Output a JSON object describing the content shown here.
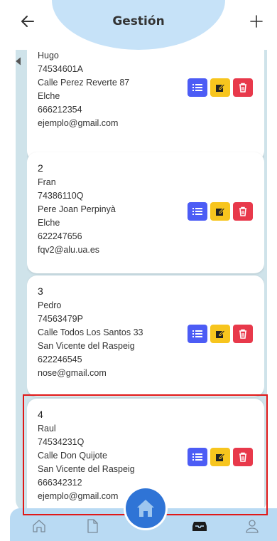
{
  "header": {
    "title": "Gestión",
    "back_icon": "arrow-left-icon",
    "add_icon": "plus-icon"
  },
  "cards": [
    {
      "id": "",
      "name": "Hugo",
      "dni": "74534601A",
      "address": "Calle Perez Reverte 87",
      "city": "Elche",
      "phone": "666212354",
      "email": "ejemplo@gmail.com"
    },
    {
      "id": "2",
      "name": "Fran",
      "dni": "74386110Q",
      "address": "Pere Joan Perpinyà",
      "city": "Elche",
      "phone": "622247656",
      "email": "fqv2@alu.ua.es"
    },
    {
      "id": "3",
      "name": "Pedro",
      "dni": "74563479P",
      "address": "Calle Todos Los Santos 33",
      "city": "San Vicente del Raspeig",
      "phone": "622246545",
      "email": "nose@gmail.com"
    },
    {
      "id": "4",
      "name": "Raul",
      "dni": "74534231Q",
      "address": "Calle Don Quijote",
      "city": "San Vicente del Raspeig",
      "phone": "666342312",
      "email": "ejemplo@gmail.com"
    }
  ],
  "card_actions": [
    "list-icon",
    "edit-icon",
    "trash-icon"
  ],
  "bottom_nav": [
    "home-outline-icon",
    "document-icon",
    "home-filled-icon",
    "inbox-icon",
    "person-icon"
  ],
  "colors": {
    "header_blob": "#c6e2f8",
    "panel": "#cfe3ea",
    "list_button": "#4c5cf5",
    "edit_button": "#f7c51e",
    "delete_button": "#e8394b",
    "nav_bar": "#b9daf3",
    "home_fab": "#2f74d6",
    "highlight": "#e01818"
  }
}
